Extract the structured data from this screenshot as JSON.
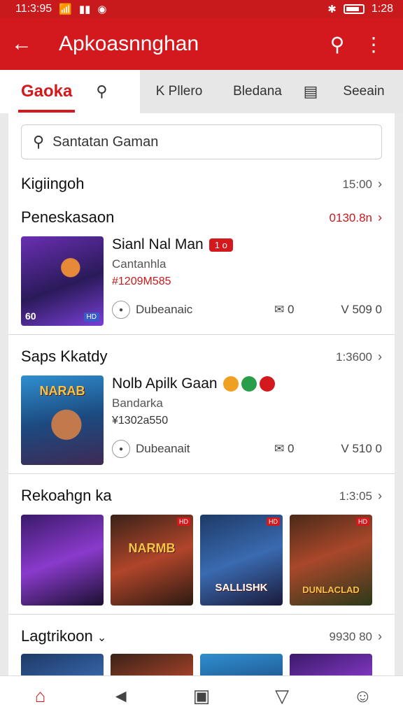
{
  "status_bar": {
    "time": "11:3:95",
    "battery_time": "1:28"
  },
  "app_bar": {
    "title": "Apkoasnnghan"
  },
  "tabs": [
    {
      "label": "Gaoka"
    },
    {
      "label": "K Pllero"
    },
    {
      "label": "Bledana"
    },
    {
      "label": "Seeain"
    }
  ],
  "search": {
    "placeholder": "Santatan Gaman"
  },
  "sections": {
    "top": {
      "title": "Kigiingoh",
      "meta": "15:00"
    },
    "first": {
      "title": "Peneskasaon",
      "meta": "0130.8n",
      "app": {
        "name": "Sianl Nal Man",
        "pill": "1 o",
        "subtitle": "Cantanhla",
        "price": "#1209M585",
        "author": "Dubeanaic",
        "mail": "0",
        "version": "V 509 0",
        "corner_left": "60"
      }
    },
    "second": {
      "title": "Saps Kkatdy",
      "meta": "1:3600",
      "app": {
        "name": "Nolb Apilk Gaan",
        "subtitle": "Bandarka",
        "price": "¥1302a550",
        "author": "Dubeanait",
        "mail": "0",
        "version": "V 510 0",
        "art_title": "NARAB"
      }
    },
    "third": {
      "title": "Rekoahgn ka",
      "meta": "1:3:05",
      "thumbs": [
        {
          "label": ""
        },
        {
          "label": "NARMB"
        },
        {
          "label": "SALLISHK"
        },
        {
          "label": "DUNLACLAD"
        }
      ]
    },
    "fourth": {
      "title": "Lagtrikoon",
      "meta": "9930 80"
    }
  },
  "colors": {
    "accent": "#d3191d",
    "status": "#c8191c"
  },
  "icons": [
    "back-arrow-icon",
    "search-icon",
    "more-vert-icon",
    "home-icon",
    "megaphone-icon",
    "tablet-icon",
    "heart-icon",
    "profile-icon"
  ]
}
